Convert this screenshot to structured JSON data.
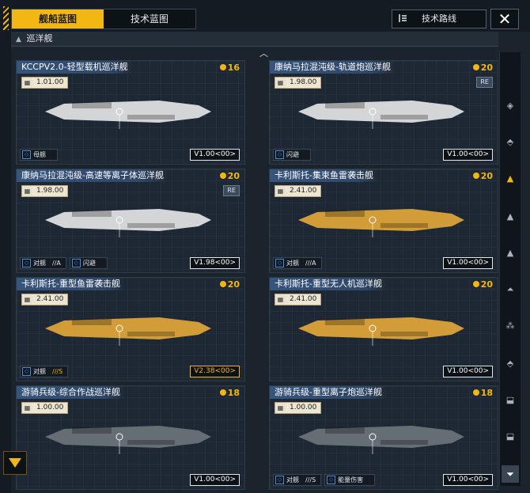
{
  "tabs": {
    "ship_blueprint": "舰船蓝图",
    "tech_blueprint": "技术蓝图"
  },
  "header": {
    "tech_route_label": "技术路线",
    "close_symbol": "✕"
  },
  "category": {
    "label": "巡洋舰"
  },
  "colors": {
    "accent": "#f2b712",
    "title_bg": "#36547d",
    "panel": "#1e2834"
  },
  "cards": [
    {
      "title": "KCCPV2.0-轻型载机巡洋舰",
      "cost": "16",
      "stat": "1.01.00",
      "re": "",
      "tags": [
        {
          "label": "母舰",
          "stripe": ""
        }
      ],
      "version": "V1.00<00>",
      "ship_color": "#e8e8e8",
      "highlight": false
    },
    {
      "title": "康纳马拉混沌级-轨道炮巡洋舰",
      "cost": "20",
      "stat": "1.98.00",
      "re": "RE",
      "tags": [
        {
          "label": "闪避",
          "stripe": ""
        }
      ],
      "version": "V1.00<00>",
      "ship_color": "#e8e8e8",
      "highlight": false
    },
    {
      "title": "康纳马拉混沌级-高速等离子体巡洋舰",
      "cost": "20",
      "stat": "1.98.00",
      "re": "RE",
      "tags": [
        {
          "label": "对舰",
          "stripe": "//A"
        },
        {
          "label": "闪避",
          "stripe": ""
        }
      ],
      "version": "V1.98<00>",
      "ship_color": "#e8e8e8",
      "highlight": false
    },
    {
      "title": "卡利斯托-集束鱼雷袭击舰",
      "cost": "20",
      "stat": "2.41.00",
      "re": "",
      "tags": [
        {
          "label": "对舰",
          "stripe": "///A"
        }
      ],
      "version": "V1.00<00>",
      "ship_color": "#e5a83a",
      "highlight": false
    },
    {
      "title": "卡利斯托-重型鱼雷袭击舰",
      "cost": "20",
      "stat": "2.41.00",
      "re": "",
      "tags": [
        {
          "label": "对舰",
          "stripe": "///S"
        }
      ],
      "version": "V2.38<00>",
      "ship_color": "#e5a83a",
      "highlight": true
    },
    {
      "title": "卡利斯托-重型无人机巡洋舰",
      "cost": "20",
      "stat": "2.41.00",
      "re": "",
      "tags": [],
      "version": "V1.00<00>",
      "ship_color": "#e5a83a",
      "highlight": false
    },
    {
      "title": "游骑兵级-综合作战巡洋舰",
      "cost": "18",
      "stat": "1.00.00",
      "re": "",
      "tags": [],
      "version": "V1.00<00>",
      "ship_color": "#6d747c",
      "highlight": false
    },
    {
      "title": "游骑兵级-重型离子炮巡洋舰",
      "cost": "18",
      "stat": "1.00.00",
      "re": "",
      "tags": [
        {
          "label": "对舰",
          "stripe": "///S"
        },
        {
          "label": "能量伤害",
          "stripe": ""
        }
      ],
      "version": "V1.00<00>",
      "ship_color": "#6d747c",
      "highlight": false
    }
  ]
}
